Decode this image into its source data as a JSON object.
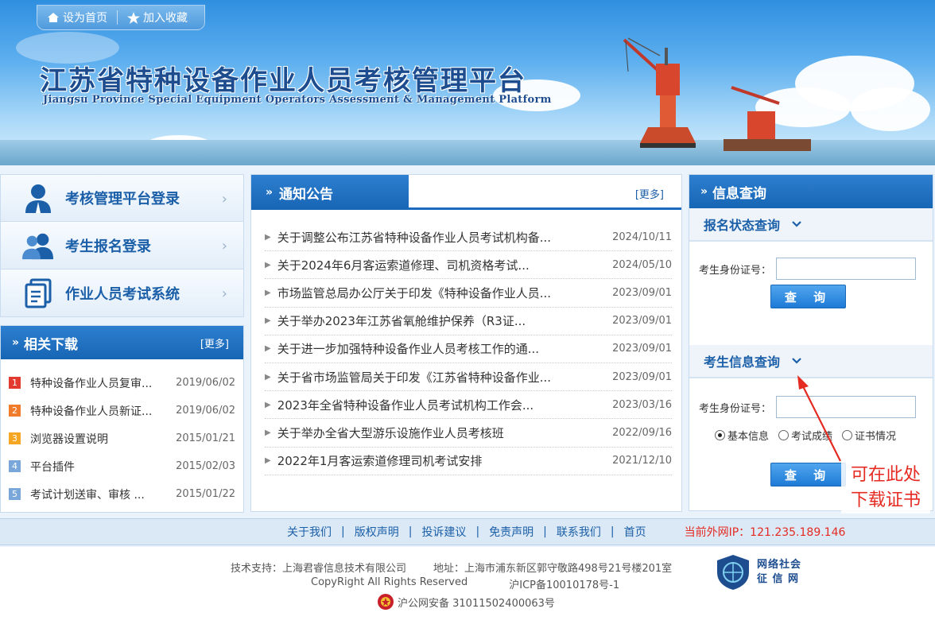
{
  "topbar": {
    "home_label": "设为首页",
    "fav_label": "加入收藏"
  },
  "header": {
    "title_cn": "江苏省特种设备作业人员考核管理平台",
    "title_en": "Jiangsu Province Special Equipment Operators Assessment & Management Platform"
  },
  "nav": [
    {
      "label": "考核管理平台登录",
      "icon": "user-icon"
    },
    {
      "label": "考生报名登录",
      "icon": "users-icon"
    },
    {
      "label": "作业人员考试系统",
      "icon": "document-icon"
    }
  ],
  "downloads": {
    "title": "相关下载",
    "more": "[更多]",
    "items": [
      {
        "num": "1",
        "title": "特种设备作业人员复审...",
        "date": "2019/06/02",
        "color": "#e23a2f"
      },
      {
        "num": "2",
        "title": "特种设备作业人员新证...",
        "date": "2019/06/02",
        "color": "#f07b2a"
      },
      {
        "num": "3",
        "title": "浏览器设置说明",
        "date": "2015/01/21",
        "color": "#f5a623"
      },
      {
        "num": "4",
        "title": "平台插件",
        "date": "2015/02/03",
        "color": "#7aa7d9"
      },
      {
        "num": "5",
        "title": "考试计划送审、审核 ...",
        "date": "2015/01/22",
        "color": "#7aa7d9"
      }
    ]
  },
  "notices": {
    "title": "通知公告",
    "more": "[更多]",
    "items": [
      {
        "title": "关于调整公布江苏省特种设备作业人员考试机构备...",
        "date": "2024/10/11"
      },
      {
        "title": "关于2024年6月客运索道修理、司机资格考试...",
        "date": "2024/05/10"
      },
      {
        "title": "市场监管总局办公厅关于印发《特种设备作业人员...",
        "date": "2023/09/01"
      },
      {
        "title": "关于举办2023年江苏省氧舱维护保养（R3证...",
        "date": "2023/09/01"
      },
      {
        "title": "关于进一步加强特种设备作业人员考核工作的通...",
        "date": "2023/09/01"
      },
      {
        "title": "关于省市场监管局关于印发《江苏省特种设备作业...",
        "date": "2023/09/01"
      },
      {
        "title": "2023年全省特种设备作业人员考试机构工作会...",
        "date": "2023/03/16"
      },
      {
        "title": "关于举办全省大型游乐设施作业人员考核班",
        "date": "2022/09/16"
      },
      {
        "title": "2022年1月客运索道修理司机考试安排",
        "date": "2021/12/10"
      }
    ]
  },
  "info": {
    "title": "信息查询",
    "reg_status": {
      "title": "报名状态查询",
      "id_label": "考生身份证号：",
      "id_value": "",
      "button": "查 询"
    },
    "exam_info": {
      "title": "考生信息查询",
      "id_label": "考生身份证号：",
      "id_value": "",
      "options": [
        {
          "label": "基本信息",
          "checked": true
        },
        {
          "label": "考试成绩",
          "checked": false
        },
        {
          "label": "证书情况",
          "checked": false
        }
      ],
      "button": "查 询"
    }
  },
  "annotation": {
    "line1": "可在此处",
    "line2": "下载证书",
    "color": "#e52a22"
  },
  "footer": {
    "links": [
      "关于我们",
      "版权声明",
      "投诉建议",
      "免责声明",
      "联系我们",
      "首页"
    ],
    "separator": "|",
    "ip": "当前外网IP：121.235.189.146",
    "support": "技术支持：上海君睿信息技术有限公司",
    "address": "地址：上海市浦东新区郭守敬路498号21号楼201室",
    "copyright": "CopyRight All Rights Reserved",
    "icp": "沪ICP备10010178号-1",
    "police": "沪公网安备 31011502400063号",
    "badge_line1": "网络社会",
    "badge_line2": "征 信 网"
  }
}
